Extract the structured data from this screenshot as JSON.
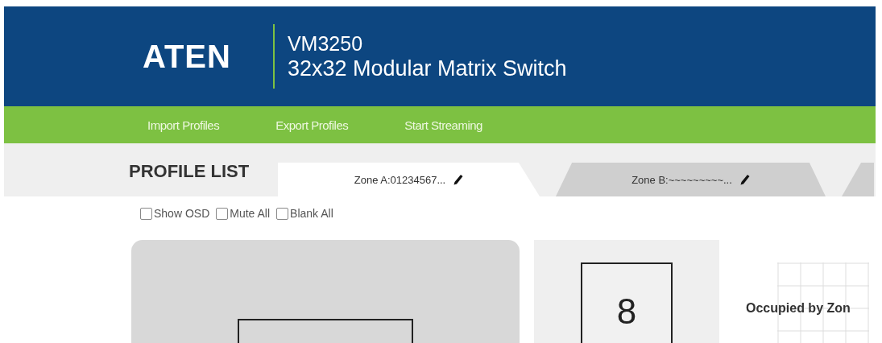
{
  "header": {
    "logo": "ATEN",
    "model": "VM3250",
    "product": "32x32 Modular Matrix Switch"
  },
  "menu": [
    {
      "label": "Import Profiles"
    },
    {
      "label": "Export Profiles"
    },
    {
      "label": "Start Streaming"
    }
  ],
  "profile_list": {
    "title": "PROFILE LIST",
    "tabs": [
      {
        "label": "Zone A:01234567...",
        "selected": true
      },
      {
        "label": "Zone B:~~~~~~~~~...",
        "selected": false
      },
      {
        "selected": false
      }
    ]
  },
  "options": [
    {
      "label": "Show OSD",
      "checked": false
    },
    {
      "label": "Mute All",
      "checked": false
    },
    {
      "label": "Blank All",
      "checked": false
    }
  ],
  "count": "8",
  "status": "Occupied by Zon"
}
